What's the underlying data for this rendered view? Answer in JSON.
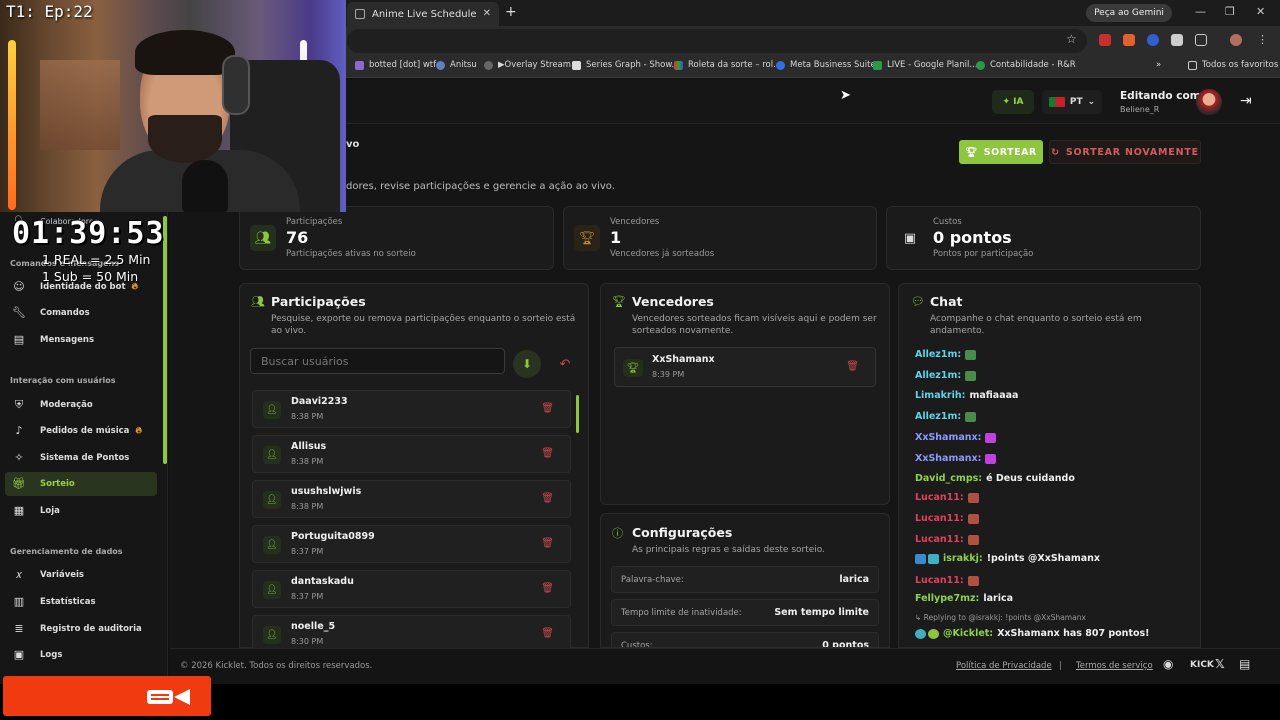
{
  "browser": {
    "tab_title": "Anime Live Schedule",
    "gemini_label": "Peça ao Gemini",
    "bookmarks": [
      "botted [dot] wtf",
      "Anitsu",
      "Overlay Stream",
      "Series Graph - Show...",
      "Roleta da sorte – rol...",
      "Meta Business Suite",
      "LIVE - Google Planil...",
      "Contabilidade - R&R"
    ],
    "all_favorites": "Todos os favoritos"
  },
  "header": {
    "ia_label": "IA",
    "lang_label": "PT",
    "editing_label": "Editando como",
    "editing_user": "Beliene_R"
  },
  "page": {
    "title_fragment": "vo",
    "subtitle_fragment": "dores, revise participações e gerencie a ação ao vivo.",
    "draw_button": "SORTEAR",
    "redraw_button": "SORTEAR NOVAMENTE"
  },
  "stats": {
    "participants": {
      "label": "Participações",
      "value": "76",
      "desc": "Participações ativas no sorteio"
    },
    "winners": {
      "label": "Vencedores",
      "value": "1",
      "desc": "Vencedores já sorteados"
    },
    "costs": {
      "label": "Custos",
      "value": "0 pontos",
      "desc": "Pontos por participação"
    }
  },
  "participations": {
    "title": "Participações",
    "desc_line1": "Pesquise, exporte ou remova participações enquanto o sorteio está",
    "desc_line2": "ao vivo.",
    "search_placeholder": "Buscar usuários",
    "items": [
      {
        "name": "Daavi2233",
        "time": "8:38 PM"
      },
      {
        "name": "Allisus",
        "time": "8:38 PM"
      },
      {
        "name": "usushslwjwis",
        "time": "8:38 PM"
      },
      {
        "name": "Portuguita0899",
        "time": "8:37 PM"
      },
      {
        "name": "dantaskadu",
        "time": "8:37 PM"
      },
      {
        "name": "noelle_5",
        "time": "8:30 PM"
      }
    ]
  },
  "winners_panel": {
    "title": "Vencedores",
    "desc_line1": "Vencedores sorteados ficam visíveis aqui e podem ser",
    "desc_line2": "sorteados novamente.",
    "items": [
      {
        "name": "XxShamanx",
        "time": "8:39 PM"
      }
    ]
  },
  "config": {
    "title": "Configurações",
    "desc": "As principais regras e saídas deste sorteio.",
    "rows": [
      {
        "key": "Palavra-chave:",
        "value": "larica"
      },
      {
        "key": "Tempo limite de inatividade:",
        "value": "Sem tempo limite"
      },
      {
        "key": "Custos:",
        "value": "0 pontos"
      }
    ]
  },
  "chat": {
    "title": "Chat",
    "desc_line1": "Acompanhe o chat enquanto o sorteio está em",
    "desc_line2": "andamento.",
    "messages": [
      {
        "user": "Allez1m:",
        "text": "",
        "color": "#5fd3e8",
        "emote": "#4a8a4a"
      },
      {
        "user": "Allez1m:",
        "text": "",
        "color": "#5fd3e8",
        "emote": "#4a8a4a"
      },
      {
        "user": "Limakrih:",
        "text": "mafiaaaa",
        "color": "#5fd3e8",
        "emote": ""
      },
      {
        "user": "Allez1m:",
        "text": "",
        "color": "#5fd3e8",
        "emote": "#4a8a4a"
      },
      {
        "user": "XxShamanx:",
        "text": "",
        "color": "#8a9aff",
        "emote": "#c040e0"
      },
      {
        "user": "XxShamanx:",
        "text": "",
        "color": "#8a9aff",
        "emote": "#c040e0"
      },
      {
        "user": "David_cmps:",
        "text": "é Deus cuidando",
        "color": "#8ed34a",
        "emote": ""
      },
      {
        "user": "Lucan11:",
        "text": "",
        "color": "#e0405a",
        "emote": "#b05040"
      },
      {
        "user": "Lucan11:",
        "text": "",
        "color": "#e0405a",
        "emote": "#b05040"
      },
      {
        "user": "Lucan11:",
        "text": "",
        "color": "#e0405a",
        "emote": "#b05040"
      },
      {
        "user": "israkkj:",
        "text": "!points @XxShamanx",
        "color": "#8ed34a",
        "emote": ""
      },
      {
        "user": "Lucan11:",
        "text": "",
        "color": "#e0405a",
        "emote": "#b05040"
      },
      {
        "user": "Fellype7mz:",
        "text": "larica",
        "color": "#8ed34a",
        "emote": ""
      }
    ],
    "reply_line": "Replying to @israkkj: !points @XxShamanx",
    "bot_user": "@Kicklet:",
    "bot_text": "XxShamanx has 807 pontos!"
  },
  "footer": {
    "copyright": "© 2026 Kicklet. Todos os direitos reservados.",
    "privacy": "Política de Privacidade",
    "separator": "|",
    "terms": "Termos de serviço",
    "kick": "KICK"
  },
  "sidebar": {
    "collab": "Colaboradores",
    "section_bot": "Comandos e mensagens",
    "items_bot": [
      {
        "label": "Identidade do bot",
        "icon": "bot-icon",
        "fire": true
      },
      {
        "label": "Comandos",
        "icon": "wrench-icon",
        "fire": false
      },
      {
        "label": "Mensagens",
        "icon": "message-icon",
        "fire": false
      }
    ],
    "section_interaction": "Interação com usuários",
    "items_interaction": [
      {
        "label": "Moderação",
        "icon": "shield-icon",
        "fire": false
      },
      {
        "label": "Pedidos de música",
        "icon": "music-icon",
        "fire": true
      },
      {
        "label": "Sistema de Pontos",
        "icon": "sparkle-icon",
        "fire": false
      },
      {
        "label": "Sorteio",
        "icon": "gift-icon",
        "fire": false,
        "active": true
      },
      {
        "label": "Loja",
        "icon": "store-icon",
        "fire": false
      }
    ],
    "section_data": "Gerenciamento de dados",
    "items_data": [
      {
        "label": "Variáveis",
        "icon": "variable-icon",
        "fire": false
      },
      {
        "label": "Estatísticas",
        "icon": "stats-icon",
        "fire": false
      },
      {
        "label": "Registro de auditoria",
        "icon": "audit-icon",
        "fire": false
      },
      {
        "label": "Logs",
        "icon": "logs-icon",
        "fire": false
      }
    ]
  },
  "overlay": {
    "episode": "T1: Ep:22",
    "timer": "01:39:53",
    "real_rate": "1 REAL = 2.5 Min",
    "sub_rate": "1 Sub = 50 Min"
  }
}
